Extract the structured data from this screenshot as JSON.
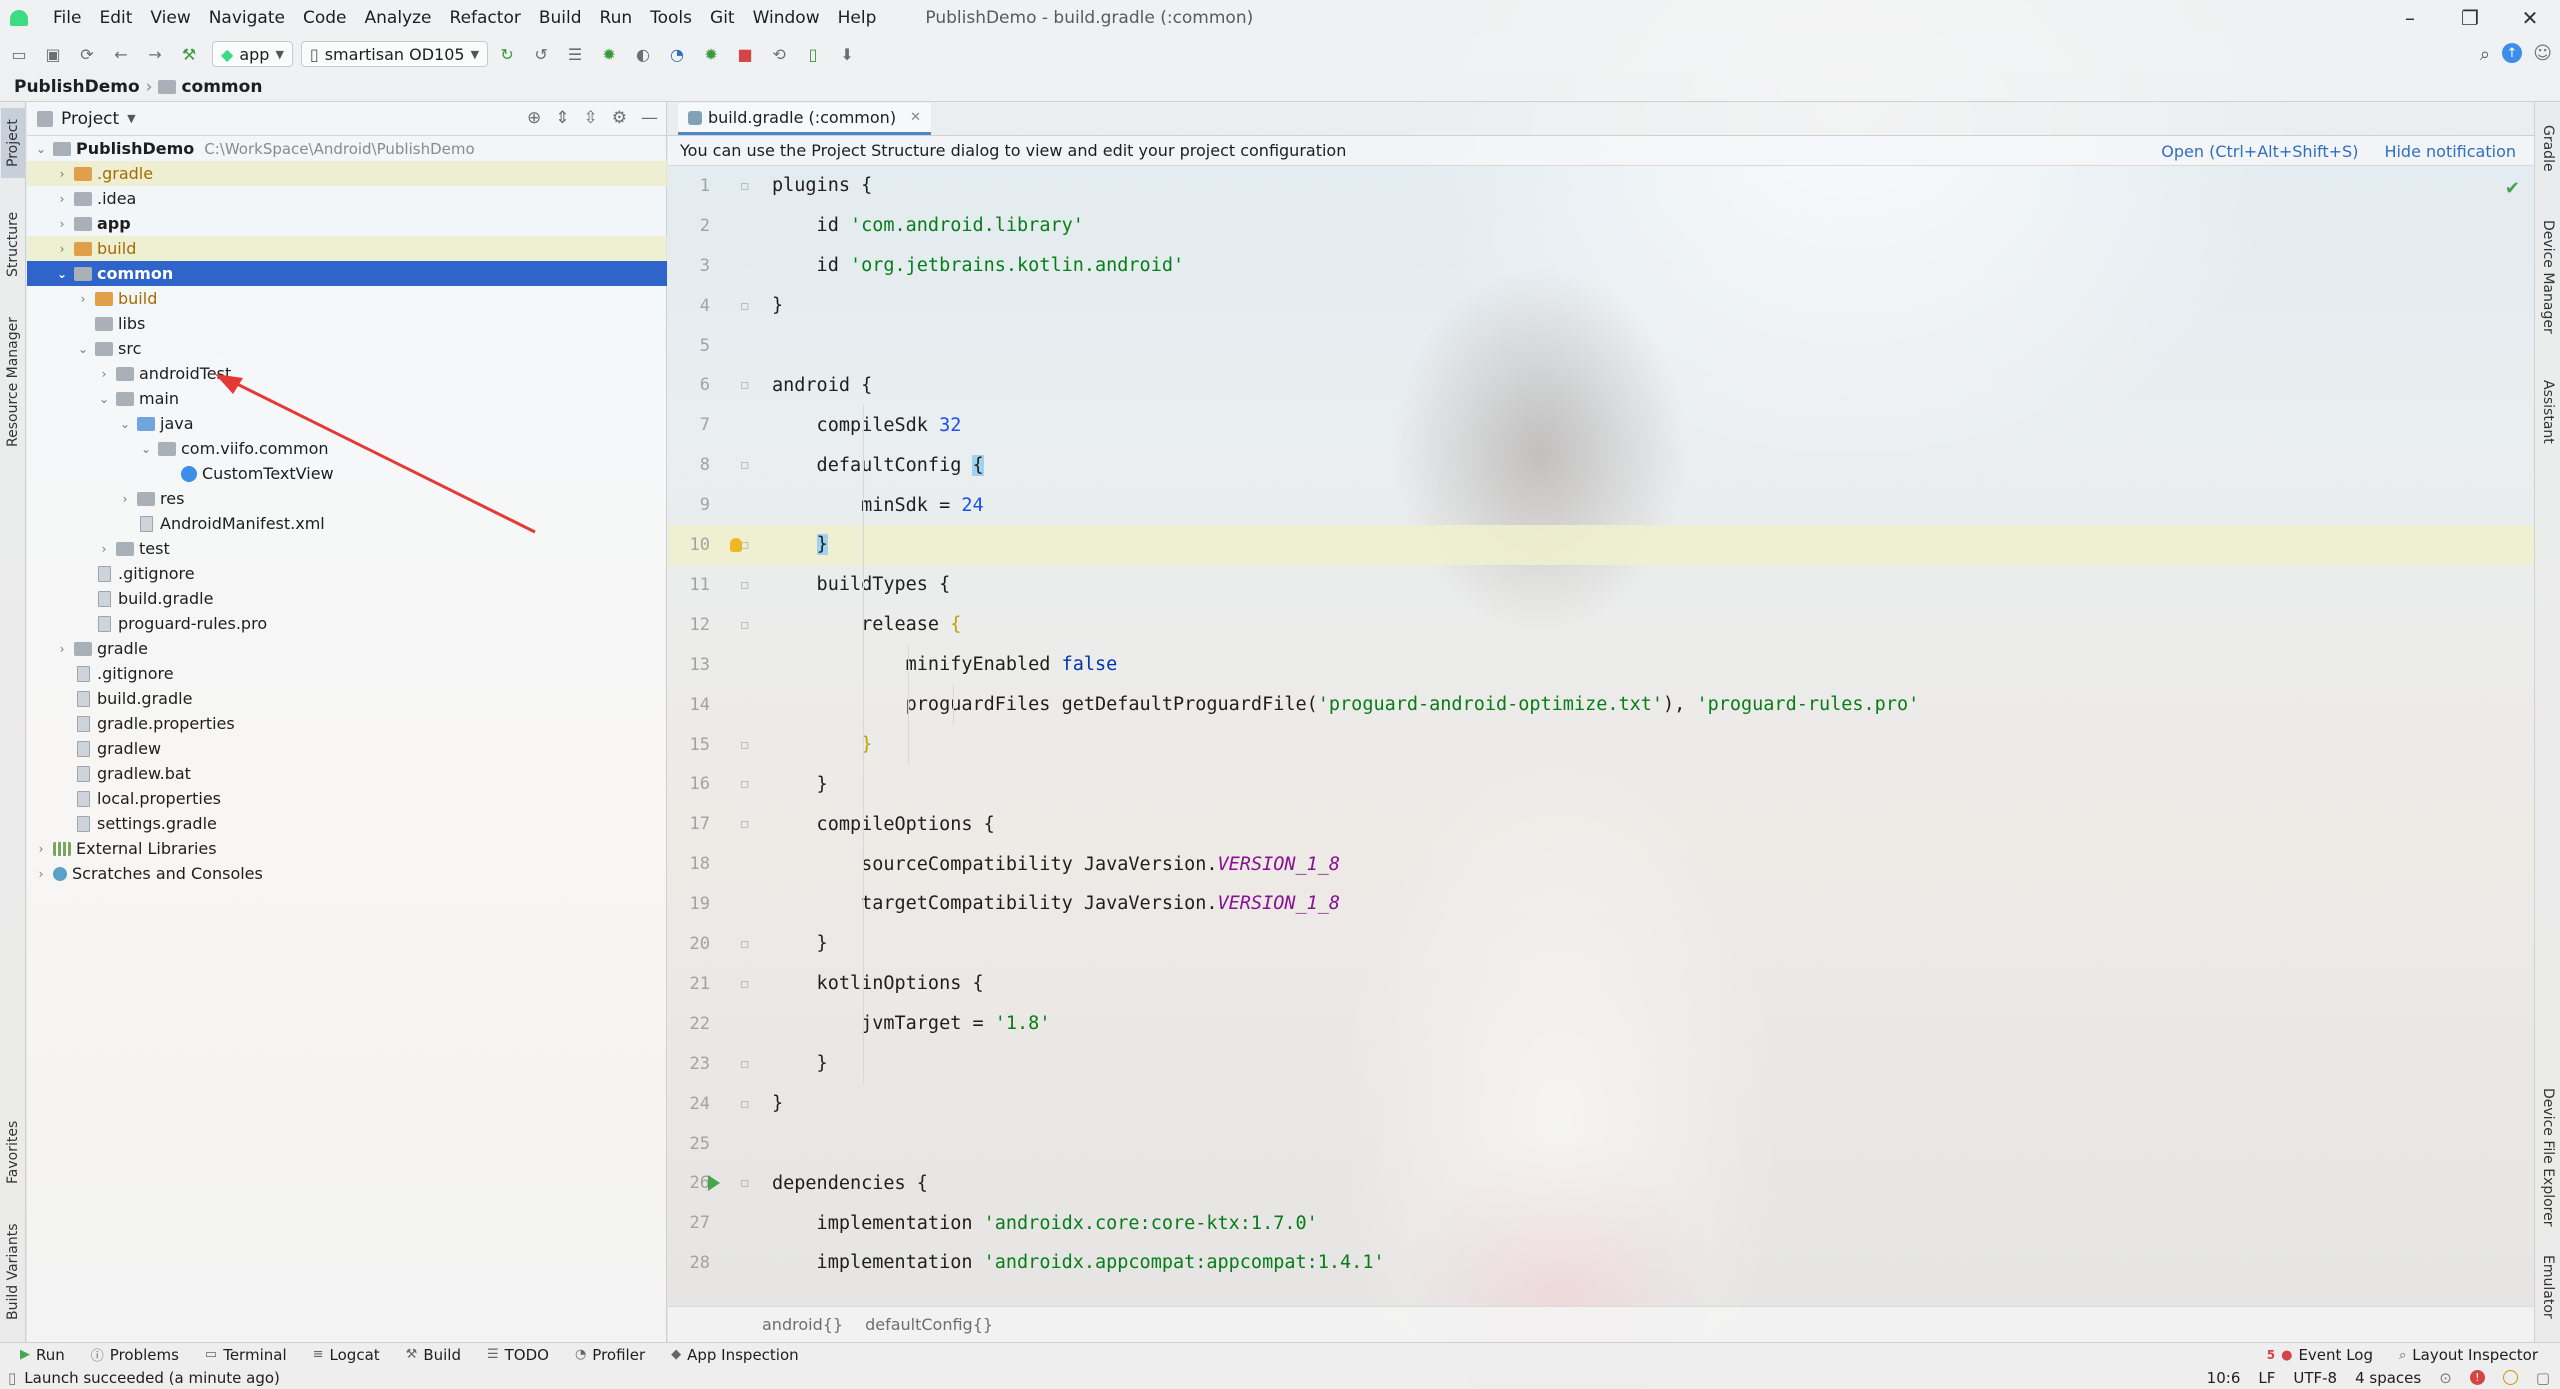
{
  "window": {
    "title": "PublishDemo - build.gradle (:common)",
    "menu": [
      "File",
      "Edit",
      "View",
      "Navigate",
      "Code",
      "Analyze",
      "Refactor",
      "Build",
      "Run",
      "Tools",
      "Git",
      "Window",
      "Help"
    ]
  },
  "toolbar": {
    "run_config": "app",
    "device": "smartisan OD105"
  },
  "breadcrumb": {
    "root": "PublishDemo",
    "current": "common"
  },
  "left_stripe": {
    "project": "Project",
    "structure": "Structure",
    "resource_manager": "Resource Manager",
    "favorites": "Favorites",
    "build_variants": "Build Variants"
  },
  "right_stripe": {
    "gradle": "Gradle",
    "device_manager": "Device Manager",
    "assistant": "Assistant",
    "device_file_explorer": "Device File Explorer",
    "emulator": "Emulator"
  },
  "project_panel": {
    "title": "Project",
    "root_name": "PublishDemo",
    "root_path": "C:\\WorkSpace\\Android\\PublishDemo",
    "tree": [
      {
        "label": ".gradle",
        "indent": 1,
        "chev": "›",
        "icon": "orange",
        "style": "orange",
        "hl": true
      },
      {
        "label": ".idea",
        "indent": 1,
        "chev": "›",
        "icon": "folder"
      },
      {
        "label": "app",
        "indent": 1,
        "chev": "›",
        "icon": "folder",
        "style": "bold"
      },
      {
        "label": "build",
        "indent": 1,
        "chev": "›",
        "icon": "orange",
        "style": "orange",
        "hl": true
      },
      {
        "label": "common",
        "indent": 1,
        "chev": "⌄",
        "icon": "folder",
        "style": "bold",
        "sel": true
      },
      {
        "label": "build",
        "indent": 2,
        "chev": "›",
        "icon": "orange",
        "style": "orange"
      },
      {
        "label": "libs",
        "indent": 2,
        "chev": "",
        "icon": "folder"
      },
      {
        "label": "src",
        "indent": 2,
        "chev": "⌄",
        "icon": "folder"
      },
      {
        "label": "androidTest",
        "indent": 3,
        "chev": "›",
        "icon": "folder"
      },
      {
        "label": "main",
        "indent": 3,
        "chev": "⌄",
        "icon": "folder"
      },
      {
        "label": "java",
        "indent": 4,
        "chev": "⌄",
        "icon": "blue"
      },
      {
        "label": "com.viifo.common",
        "indent": 5,
        "chev": "⌄",
        "icon": "folder"
      },
      {
        "label": "CustomTextView",
        "indent": 6,
        "chev": "",
        "icon": "class"
      },
      {
        "label": "res",
        "indent": 4,
        "chev": "›",
        "icon": "folder"
      },
      {
        "label": "AndroidManifest.xml",
        "indent": 4,
        "chev": "",
        "icon": "file"
      },
      {
        "label": "test",
        "indent": 3,
        "chev": "›",
        "icon": "folder"
      },
      {
        "label": ".gitignore",
        "indent": 2,
        "chev": "",
        "icon": "file"
      },
      {
        "label": "build.gradle",
        "indent": 2,
        "chev": "",
        "icon": "file"
      },
      {
        "label": "proguard-rules.pro",
        "indent": 2,
        "chev": "",
        "icon": "file"
      },
      {
        "label": "gradle",
        "indent": 1,
        "chev": "›",
        "icon": "folder"
      },
      {
        "label": ".gitignore",
        "indent": 1,
        "chev": "",
        "icon": "file"
      },
      {
        "label": "build.gradle",
        "indent": 1,
        "chev": "",
        "icon": "file"
      },
      {
        "label": "gradle.properties",
        "indent": 1,
        "chev": "",
        "icon": "file"
      },
      {
        "label": "gradlew",
        "indent": 1,
        "chev": "",
        "icon": "file"
      },
      {
        "label": "gradlew.bat",
        "indent": 1,
        "chev": "",
        "icon": "file"
      },
      {
        "label": "local.properties",
        "indent": 1,
        "chev": "",
        "icon": "file"
      },
      {
        "label": "settings.gradle",
        "indent": 1,
        "chev": "",
        "icon": "file"
      },
      {
        "label": "External Libraries",
        "indent": 0,
        "chev": "›",
        "icon": "lib"
      },
      {
        "label": "Scratches and Consoles",
        "indent": 0,
        "chev": "›",
        "icon": "scratch"
      }
    ]
  },
  "editor": {
    "tab": "build.gradle (:common)",
    "notification": "You can use the Project Structure dialog to view and edit your project configuration",
    "notif_open": "Open (Ctrl+Alt+Shift+S)",
    "notif_hide": "Hide notification",
    "current_line": 10,
    "lines": [
      [
        [
          "plugins ",
          ""
        ],
        [
          "{",
          "brace"
        ]
      ],
      [
        [
          "    id ",
          ""
        ],
        [
          "'com.android.library'",
          "str"
        ]
      ],
      [
        [
          "    id ",
          ""
        ],
        [
          "'org.jetbrains.kotlin.android'",
          "str"
        ]
      ],
      [
        [
          "}",
          "brace"
        ]
      ],
      [],
      [
        [
          "android ",
          ""
        ],
        [
          "{",
          "brace"
        ]
      ],
      [
        [
          "    compileSdk ",
          ""
        ],
        [
          "32",
          "num"
        ]
      ],
      [
        [
          "    defaultConfig ",
          ""
        ],
        [
          "{",
          "brace mark"
        ]
      ],
      [
        [
          "        minSdk = ",
          ""
        ],
        [
          "24",
          "num"
        ]
      ],
      [
        [
          "    ",
          ""
        ],
        [
          "}",
          "brace mark"
        ]
      ],
      [
        [
          "    buildTypes ",
          ""
        ],
        [
          "{",
          "brace"
        ]
      ],
      [
        [
          "        release ",
          ""
        ],
        [
          "{",
          "brace y"
        ]
      ],
      [
        [
          "            minifyEnabled ",
          ""
        ],
        [
          "false",
          "kw"
        ]
      ],
      [
        [
          "            proguardFiles getDefaultProguardFile(",
          ""
        ],
        [
          "'proguard-android-optimize.txt'",
          "str"
        ],
        [
          "), ",
          ""
        ],
        [
          "'proguard-rules.pro'",
          "str"
        ]
      ],
      [
        [
          "        ",
          ""
        ],
        [
          "}",
          "brace y"
        ]
      ],
      [
        [
          "    }",
          "brace"
        ]
      ],
      [
        [
          "    compileOptions ",
          ""
        ],
        [
          "{",
          "brace"
        ]
      ],
      [
        [
          "        sourceCompatibility JavaVersion.",
          ""
        ],
        [
          "VERSION_1_8",
          "it"
        ]
      ],
      [
        [
          "        targetCompatibility JavaVersion.",
          ""
        ],
        [
          "VERSION_1_8",
          "it"
        ]
      ],
      [
        [
          "    }",
          "brace"
        ]
      ],
      [
        [
          "    kotlinOptions ",
          ""
        ],
        [
          "{",
          "brace"
        ]
      ],
      [
        [
          "        jvmTarget = ",
          ""
        ],
        [
          "'1.8'",
          "str"
        ]
      ],
      [
        [
          "    }",
          "brace"
        ]
      ],
      [
        [
          "}",
          "brace"
        ]
      ],
      [],
      [
        [
          "dependencies ",
          ""
        ],
        [
          "{",
          "brace"
        ]
      ],
      [
        [
          "    implementation ",
          ""
        ],
        [
          "'androidx.core:core-ktx:1.7.0'",
          "str"
        ]
      ],
      [
        [
          "    implementation ",
          ""
        ],
        [
          "'androidx.appcompat:appcompat:1.4.1'",
          "str"
        ]
      ]
    ],
    "bottom_crumbs": [
      "android{}",
      "defaultConfig{}"
    ]
  },
  "bottom_tools": {
    "left": [
      "Run",
      "Problems",
      "Terminal",
      "Logcat",
      "Build",
      "TODO",
      "Profiler",
      "App Inspection"
    ],
    "event_log": "Event Log",
    "event_log_count": "5",
    "layout_inspector": "Layout Inspector"
  },
  "status": {
    "message": "Launch succeeded (a minute ago)",
    "position": "10:6",
    "line_sep": "LF",
    "encoding": "UTF-8",
    "indent": "4 spaces"
  }
}
